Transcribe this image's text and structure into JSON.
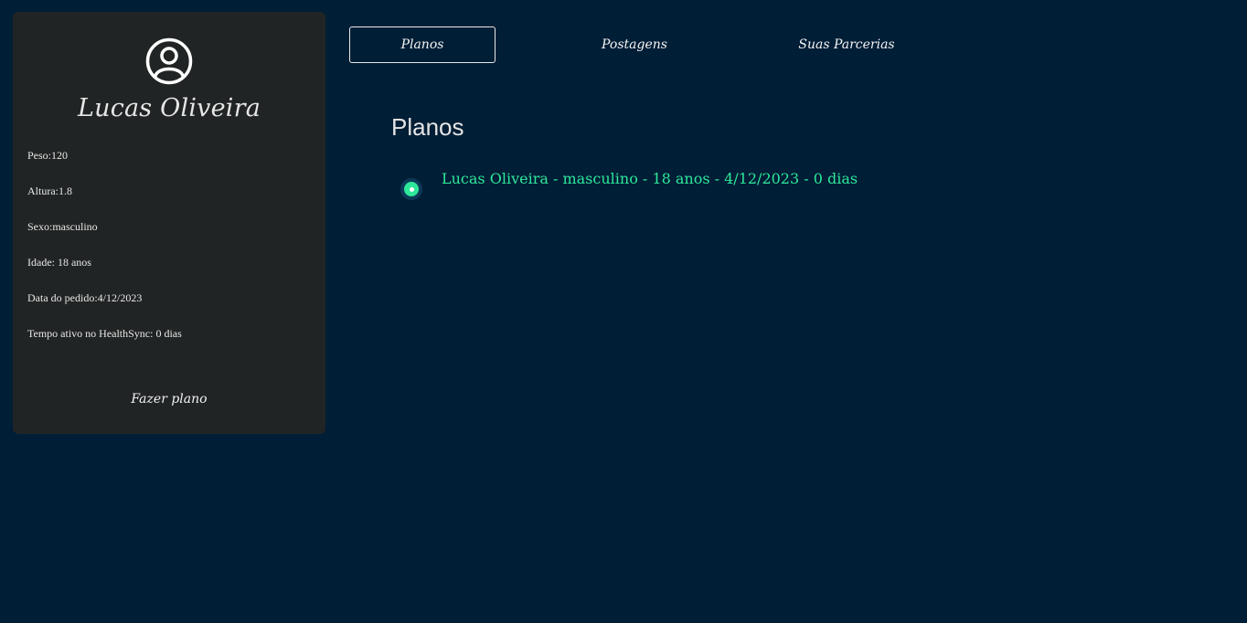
{
  "profile": {
    "name": "Lucas Oliveira",
    "avatar_icon": "user-circle-icon",
    "info": [
      "Peso:120",
      "Altura:1.8",
      "Sexo:masculino",
      "Idade: 18 anos",
      "Data do pedido:4/12/2023",
      "Tempo ativo no HealthSync: 0 dias"
    ],
    "action_label": "Fazer plano"
  },
  "tabs": [
    {
      "label": "Planos",
      "active": true
    },
    {
      "label": "Postagens",
      "active": false
    },
    {
      "label": "Suas Parcerias",
      "active": false
    }
  ],
  "main": {
    "title": "Planos",
    "plans": [
      {
        "label": "Lucas Oliveira - masculino - 18 anos - 4/12/2023 - 0 dias",
        "selected": true
      }
    ]
  },
  "colors": {
    "background": "#001e36",
    "card": "#212424",
    "accent": "#2ee89a"
  }
}
